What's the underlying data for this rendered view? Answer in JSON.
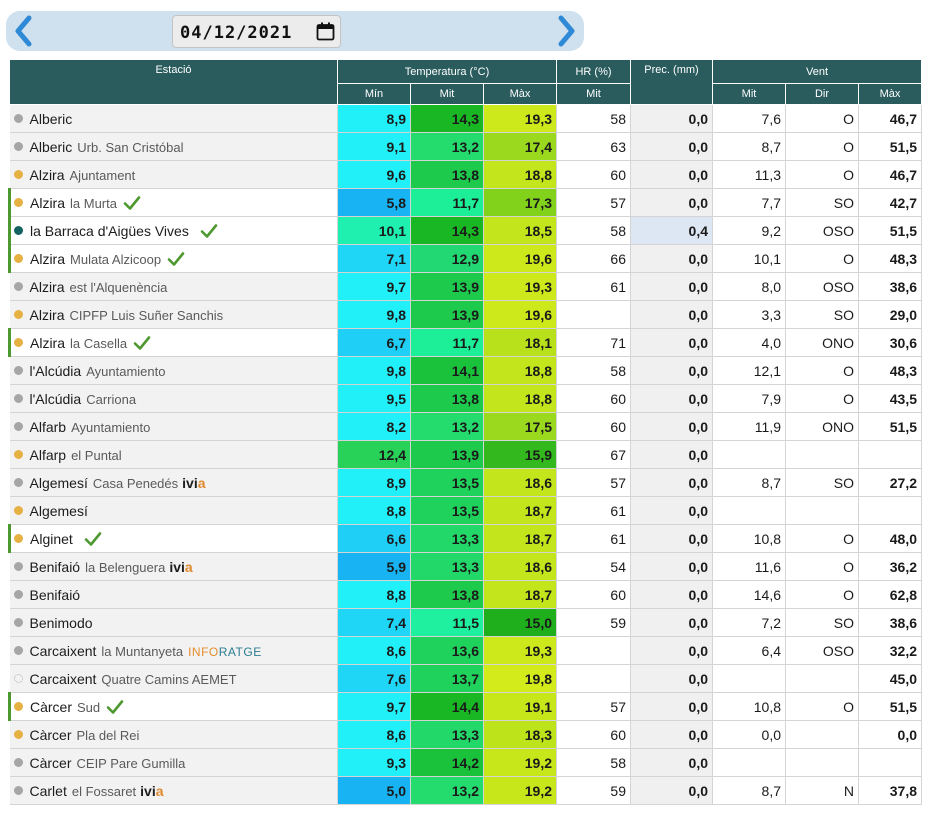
{
  "date_picker": {
    "value": "04/12/2021",
    "prev_icon": "chevron-left-icon",
    "next_icon": "chevron-right-icon",
    "calendar_icon": "calendar-icon"
  },
  "headers": {
    "station": "Estació",
    "temperature": "Temperatura (°C)",
    "hr": "HR (%)",
    "prec": "Prec. (mm)",
    "wind": "Vent",
    "min": "Mín",
    "mit": "Mit",
    "max": "Màx",
    "hr_mit": "Mit",
    "wind_mit": "Mit",
    "wind_dir": "Dir",
    "wind_max": "Màx"
  },
  "colors": {
    "header_bg": "#2a5b5d",
    "dot_gray": "#a6a6a6",
    "dot_yellow": "#e4b142",
    "dot_teal": "#136160",
    "check_green": "#4e9830",
    "ivia_accent": "#e08a2f"
  },
  "rows": [
    {
      "name": "Alberic",
      "loc": "",
      "dot": "gray",
      "check": false,
      "logo": "",
      "min": "8,9",
      "mit": "14,3",
      "max": "19,3",
      "hr": "58",
      "prec": "0,0",
      "w_mit": "7,6",
      "w_dir": "O",
      "w_max": "46,7",
      "c": [
        "#22f0f8",
        "#18b723",
        "#cde81b"
      ]
    },
    {
      "name": "Alberic",
      "loc": "Urb. San Cristóbal",
      "dot": "gray",
      "check": false,
      "logo": "",
      "min": "9,1",
      "mit": "13,2",
      "max": "17,4",
      "hr": "63",
      "prec": "0,0",
      "w_mit": "8,7",
      "w_dir": "O",
      "w_max": "51,5",
      "c": [
        "#22f0f8",
        "#24dc6d",
        "#9ad91e"
      ]
    },
    {
      "name": "Alzira",
      "loc": "Ajuntament",
      "dot": "yellow",
      "check": false,
      "logo": "",
      "min": "9,6",
      "mit": "13,8",
      "max": "18,8",
      "hr": "60",
      "prec": "0,0",
      "w_mit": "11,3",
      "w_dir": "O",
      "w_max": "46,7",
      "c": [
        "#22f0f8",
        "#1dca4b",
        "#c2e51b"
      ]
    },
    {
      "name": "Alzira",
      "loc": "la Murta",
      "dot": "yellow",
      "check": true,
      "logo": "",
      "min": "5,8",
      "mit": "11,7",
      "max": "17,3",
      "hr": "57",
      "prec": "0,0",
      "w_mit": "7,7",
      "w_dir": "SO",
      "w_max": "42,7",
      "c": [
        "#17b3f2",
        "#1cef98",
        "#82d21c"
      ],
      "sel": true
    },
    {
      "name": "la Barraca d'Aigües Vives",
      "loc": "",
      "dot": "teal",
      "check": true,
      "logo": "",
      "min": "10,1",
      "mit": "14,3",
      "max": "18,5",
      "hr": "58",
      "prec": "0,4",
      "w_mit": "9,2",
      "w_dir": "OSO",
      "w_max": "51,5",
      "c": [
        "#1ff0b0",
        "#18b723",
        "#c2e51b"
      ],
      "sel": true,
      "hl": true
    },
    {
      "name": "Alzira",
      "loc": "Mulata Alzicoop",
      "dot": "yellow",
      "check": true,
      "logo": "",
      "min": "7,1",
      "mit": "12,9",
      "max": "19,6",
      "hr": "66",
      "prec": "0,0",
      "w_mit": "10,1",
      "w_dir": "O",
      "w_max": "48,3",
      "c": [
        "#1fd6f6",
        "#22d872",
        "#cde81b"
      ],
      "sel": true
    },
    {
      "name": "Alzira",
      "loc": "est l'Alquenència",
      "dot": "gray",
      "check": false,
      "logo": "",
      "min": "9,7",
      "mit": "13,9",
      "max": "19,3",
      "hr": "61",
      "prec": "0,0",
      "w_mit": "8,0",
      "w_dir": "OSO",
      "w_max": "38,6",
      "c": [
        "#22f0f8",
        "#1dca4b",
        "#cde81b"
      ]
    },
    {
      "name": "Alzira",
      "loc": "CIPFP Luis Suñer Sanchis",
      "dot": "yellow",
      "check": false,
      "logo": "",
      "min": "9,8",
      "mit": "13,9",
      "max": "19,6",
      "hr": "",
      "prec": "0,0",
      "w_mit": "3,3",
      "w_dir": "SO",
      "w_max": "29,0",
      "c": [
        "#22f0f8",
        "#1dca4b",
        "#cde81b"
      ]
    },
    {
      "name": "Alzira",
      "loc": "la Casella",
      "dot": "yellow",
      "check": true,
      "logo": "",
      "min": "6,7",
      "mit": "11,7",
      "max": "18,1",
      "hr": "71",
      "prec": "0,0",
      "w_mit": "4,0",
      "w_dir": "ONO",
      "w_max": "30,6",
      "c": [
        "#1fcff5",
        "#1cef98",
        "#b8e11b"
      ],
      "sel": true
    },
    {
      "name": "l'Alcúdia",
      "loc": "Ayuntamiento",
      "dot": "gray",
      "check": false,
      "logo": "",
      "min": "9,8",
      "mit": "14,1",
      "max": "18,8",
      "hr": "58",
      "prec": "0,0",
      "w_mit": "12,1",
      "w_dir": "O",
      "w_max": "48,3",
      "c": [
        "#22f0f8",
        "#1ac23c",
        "#c2e51b"
      ]
    },
    {
      "name": "l'Alcúdia",
      "loc": "Carriona",
      "dot": "gray",
      "check": false,
      "logo": "",
      "min": "9,5",
      "mit": "13,8",
      "max": "18,8",
      "hr": "60",
      "prec": "0,0",
      "w_mit": "7,9",
      "w_dir": "O",
      "w_max": "43,5",
      "c": [
        "#22f0f8",
        "#1dca4b",
        "#c2e51b"
      ]
    },
    {
      "name": "Alfarb",
      "loc": "Ayuntamiento",
      "dot": "gray",
      "check": false,
      "logo": "",
      "min": "8,2",
      "mit": "13,2",
      "max": "17,5",
      "hr": "60",
      "prec": "0,0",
      "w_mit": "11,9",
      "w_dir": "ONO",
      "w_max": "51,5",
      "c": [
        "#22f0f8",
        "#24dc6d",
        "#9ad91e"
      ]
    },
    {
      "name": "Alfarp",
      "loc": "el Puntal",
      "dot": "yellow",
      "check": false,
      "logo": "",
      "min": "12,4",
      "mit": "13,9",
      "max": "15,9",
      "hr": "67",
      "prec": "0,0",
      "w_mit": "",
      "w_dir": "",
      "w_max": "",
      "c": [
        "#28d158",
        "#1dca4b",
        "#33b81e"
      ]
    },
    {
      "name": "Algemesí",
      "loc": "Casa Penedés",
      "dot": "gray",
      "check": false,
      "logo": "ivia",
      "min": "8,9",
      "mit": "13,5",
      "max": "18,6",
      "hr": "57",
      "prec": "0,0",
      "w_mit": "8,7",
      "w_dir": "SO",
      "w_max": "27,2",
      "c": [
        "#22f0f8",
        "#1fd25c",
        "#c2e51b"
      ]
    },
    {
      "name": "Algemesí",
      "loc": "",
      "dot": "yellow",
      "check": false,
      "logo": "",
      "min": "8,8",
      "mit": "13,5",
      "max": "18,7",
      "hr": "61",
      "prec": "0,0",
      "w_mit": "",
      "w_dir": "",
      "w_max": "",
      "c": [
        "#22f0f8",
        "#1fd25c",
        "#c2e51b"
      ]
    },
    {
      "name": "Alginet",
      "loc": "",
      "dot": "yellow",
      "check": true,
      "logo": "",
      "min": "6,6",
      "mit": "13,3",
      "max": "18,7",
      "hr": "61",
      "prec": "0,0",
      "w_mit": "10,8",
      "w_dir": "O",
      "w_max": "48,0",
      "c": [
        "#1fcff5",
        "#22d868",
        "#c2e51b"
      ],
      "sel": true
    },
    {
      "name": "Benifaió",
      "loc": "la Belenguera",
      "dot": "gray",
      "check": false,
      "logo": "ivia",
      "min": "5,9",
      "mit": "13,3",
      "max": "18,6",
      "hr": "54",
      "prec": "0,0",
      "w_mit": "11,6",
      "w_dir": "O",
      "w_max": "36,2",
      "c": [
        "#17b3f2",
        "#22d868",
        "#c2e51b"
      ]
    },
    {
      "name": "Benifaió",
      "loc": "",
      "dot": "gray",
      "check": false,
      "logo": "",
      "min": "8,8",
      "mit": "13,8",
      "max": "18,7",
      "hr": "60",
      "prec": "0,0",
      "w_mit": "14,6",
      "w_dir": "O",
      "w_max": "62,8",
      "c": [
        "#22f0f8",
        "#1dca4b",
        "#c2e51b"
      ]
    },
    {
      "name": "Benimodo",
      "loc": "",
      "dot": "gray",
      "check": false,
      "logo": "",
      "min": "7,4",
      "mit": "11,5",
      "max": "15,0",
      "hr": "59",
      "prec": "0,0",
      "w_mit": "7,2",
      "w_dir": "SO",
      "w_max": "38,6",
      "c": [
        "#1fd6f6",
        "#1ff0a0",
        "#1fae1c"
      ]
    },
    {
      "name": "Carcaixent",
      "loc": "la Muntanyeta",
      "dot": "gray",
      "check": false,
      "logo": "inforatge",
      "min": "8,6",
      "mit": "13,6",
      "max": "19,3",
      "hr": "",
      "prec": "0,0",
      "w_mit": "6,4",
      "w_dir": "OSO",
      "w_max": "32,2",
      "c": [
        "#22f0f8",
        "#1fd25c",
        "#cde81b"
      ]
    },
    {
      "name": "Carcaixent",
      "loc": "Quatre Camins AEMET",
      "dot": "empty",
      "check": false,
      "logo": "",
      "min": "7,6",
      "mit": "13,7",
      "max": "19,8",
      "hr": "",
      "prec": "0,0",
      "w_mit": "",
      "w_dir": "",
      "w_max": "45,0",
      "c": [
        "#1fd6f6",
        "#1fd25c",
        "#d3ea1b"
      ]
    },
    {
      "name": "Càrcer",
      "loc": "Sud",
      "dot": "yellow",
      "check": true,
      "logo": "",
      "min": "9,7",
      "mit": "14,4",
      "max": "19,1",
      "hr": "57",
      "prec": "0,0",
      "w_mit": "10,8",
      "w_dir": "O",
      "w_max": "51,5",
      "c": [
        "#22f0f8",
        "#18b723",
        "#c8e71b"
      ],
      "sel": true
    },
    {
      "name": "Càrcer",
      "loc": "Pla del Rei",
      "dot": "yellow",
      "check": false,
      "logo": "",
      "min": "8,6",
      "mit": "13,3",
      "max": "18,3",
      "hr": "60",
      "prec": "0,0",
      "w_mit": "0,0",
      "w_dir": "",
      "w_max": "0,0",
      "c": [
        "#22f0f8",
        "#22d868",
        "#bde31b"
      ]
    },
    {
      "name": "Càrcer",
      "loc": "CEIP Pare Gumilla",
      "dot": "gray",
      "check": false,
      "logo": "",
      "min": "9,3",
      "mit": "14,2",
      "max": "19,2",
      "hr": "58",
      "prec": "0,0",
      "w_mit": "",
      "w_dir": "",
      "w_max": "",
      "c": [
        "#22f0f8",
        "#1ac23c",
        "#c8e71b"
      ]
    },
    {
      "name": "Carlet",
      "loc": "el Fossaret",
      "dot": "gray",
      "check": false,
      "logo": "ivia",
      "min": "5,0",
      "mit": "13,2",
      "max": "19,2",
      "hr": "59",
      "prec": "0,0",
      "w_mit": "8,7",
      "w_dir": "N",
      "w_max": "37,8",
      "c": [
        "#17b3f2",
        "#24dc6d",
        "#c8e71b"
      ]
    }
  ]
}
